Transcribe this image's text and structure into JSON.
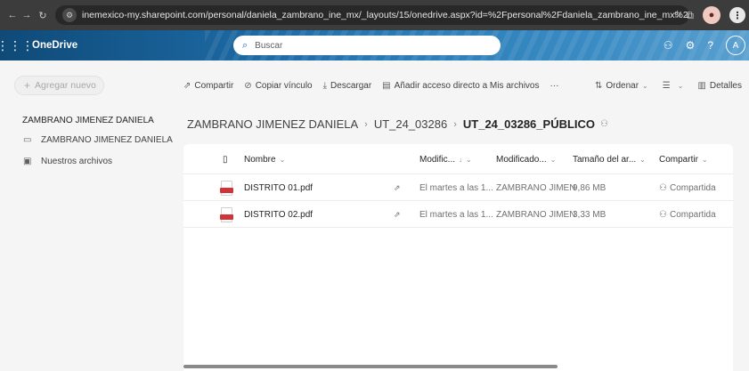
{
  "browser": {
    "url": "inemexico-my.sharepoint.com/personal/daniela_zambrano_ine_mx/_layouts/15/onedrive.aspx?id=%2Fpersonal%2Fdaniela_zambrano_ine_mx%2FDocu...",
    "back_icon": "←",
    "forward_icon": "→",
    "reload_icon": "↻",
    "star_icon": "☆",
    "extension_icon": "⧉",
    "kebab_icon": "⋮"
  },
  "app": {
    "name": "OneDrive",
    "search_placeholder": "Buscar",
    "avatar_initial": "A",
    "help_icon": "?"
  },
  "leftnav": {
    "add_new": "Agregar nuevo",
    "heading": "ZAMBRANO JIMENEZ DANIELA",
    "items": [
      {
        "label": "ZAMBRANO JIMENEZ DANIELA"
      },
      {
        "label": "Nuestros archivos"
      }
    ]
  },
  "toolbar": {
    "share": "Compartir",
    "copy_link": "Copiar vínculo",
    "download": "Descargar",
    "add_shortcut": "Añadir acceso directo a Mis archivos",
    "more": "···",
    "sort": "Ordenar",
    "details": "Detalles"
  },
  "breadcrumb": {
    "items": [
      "ZAMBRANO JIMENEZ DANIELA",
      "UT_24_03286"
    ],
    "current": "UT_24_03286_PÚBLICO"
  },
  "columns": {
    "name": "Nombre",
    "modified": "Modific...",
    "modified_by": "Modificado...",
    "size": "Tamaño del ar...",
    "share": "Compartir"
  },
  "files": [
    {
      "name": "DISTRITO 01.pdf",
      "modified": "El martes a las 1...",
      "modified_by": "ZAMBRANO JIMEN",
      "size": "9,86 MB",
      "sharing": "Compartida"
    },
    {
      "name": "DISTRITO 02.pdf",
      "modified": "El martes a las 1...",
      "modified_by": "ZAMBRANO JIMEN",
      "size": "3,33 MB",
      "sharing": "Compartida"
    }
  ]
}
